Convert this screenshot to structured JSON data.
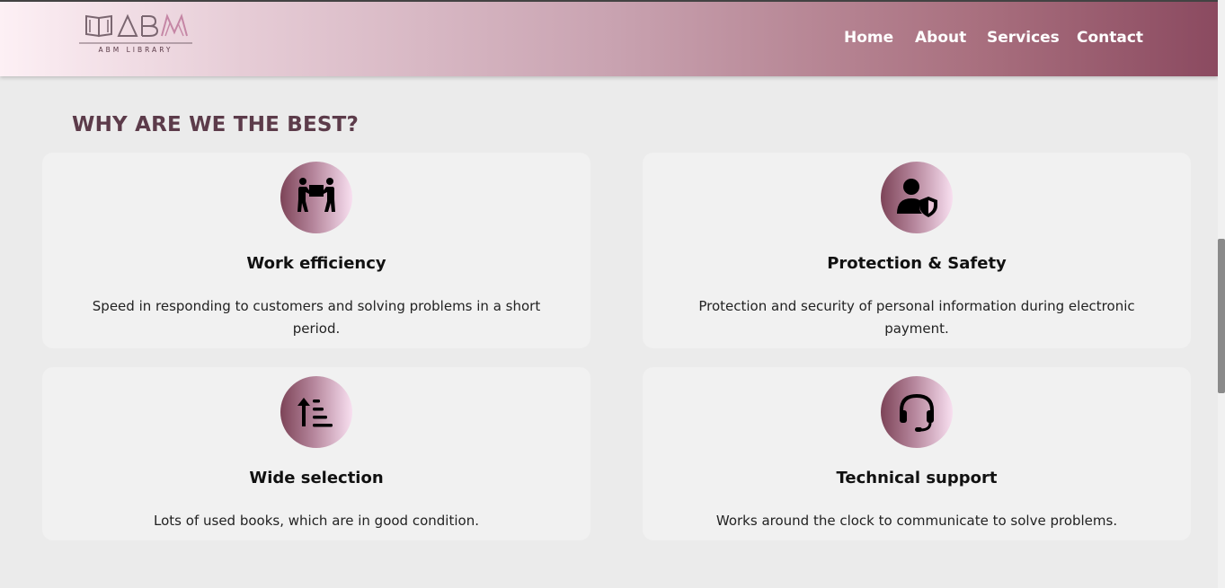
{
  "brand": {
    "logo_text": "ABM",
    "logo_subtitle": "ABM LIBRARY"
  },
  "nav": {
    "items": [
      {
        "label": "Home"
      },
      {
        "label": "About"
      },
      {
        "label": "Services"
      },
      {
        "label": "Contact"
      }
    ]
  },
  "section": {
    "title": "WHY ARE WE THE BEST?"
  },
  "features": [
    {
      "title": "Work efficiency",
      "text": "Speed in responding to customers and solving problems in a short period.",
      "icon": "people-carrying-box-icon"
    },
    {
      "title": "Protection & Safety",
      "text": "Protection and security of personal information during electronic payment.",
      "icon": "user-shield-icon"
    },
    {
      "title": "Wide selection",
      "text": "Lots of used books, which are in good condition.",
      "icon": "sort-ascending-list-icon"
    },
    {
      "title": "Technical support",
      "text": "Works around the clock to communicate to solve problems.",
      "icon": "headset-icon"
    }
  ],
  "colors": {
    "title": "#5c3b4a",
    "accent_dark": "#8b4a60",
    "accent_light": "#fdf0f5"
  }
}
